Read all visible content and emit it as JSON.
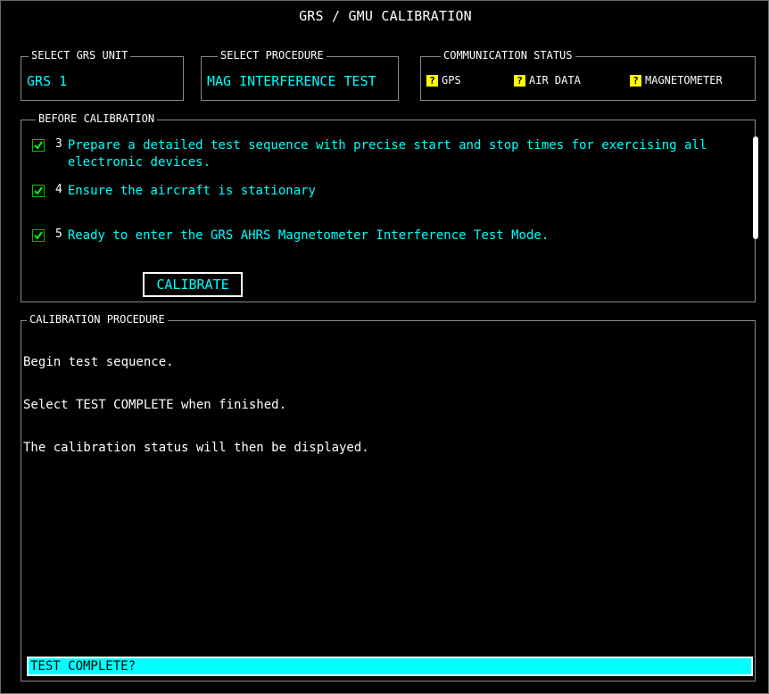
{
  "title": "GRS / GMU CALIBRATION",
  "select_unit": {
    "label": "SELECT GRS UNIT",
    "value": "GRS 1"
  },
  "select_procedure": {
    "label": "SELECT PROCEDURE",
    "value": "MAG INTERFERENCE TEST"
  },
  "communication_status": {
    "label": "COMMUNICATION STATUS",
    "items": [
      {
        "label": "GPS",
        "icon": "question-status-icon",
        "status_color": "#ffff00"
      },
      {
        "label": "AIR DATA",
        "icon": "question-status-icon",
        "status_color": "#ffff00"
      },
      {
        "label": "MAGNETOMETER",
        "icon": "question-status-icon",
        "status_color": "#ffff00"
      }
    ],
    "status_glyph": "?"
  },
  "before_calibration": {
    "label": "BEFORE CALIBRATION",
    "steps": [
      {
        "num": "3",
        "text": "Prepare a detailed test sequence with precise start and stop times for exercising all electronic devices.",
        "checked": true
      },
      {
        "num": "4",
        "text": "Ensure the aircraft is stationary",
        "checked": true
      },
      {
        "num": "5",
        "text": "Ready to enter the GRS AHRS Magnetometer Interference Test Mode.",
        "checked": true
      }
    ],
    "calibrate_label": "CALIBRATE"
  },
  "calibration_procedure": {
    "label": "CALIBRATION PROCEDURE",
    "lines": [
      "Begin test sequence.",
      "Select TEST COMPLETE when finished.",
      "The calibration status will then be displayed."
    ],
    "prompt": "TEST COMPLETE?"
  },
  "colors": {
    "accent": "#00ffff",
    "warning": "#ffff00",
    "check": "#00c000"
  }
}
